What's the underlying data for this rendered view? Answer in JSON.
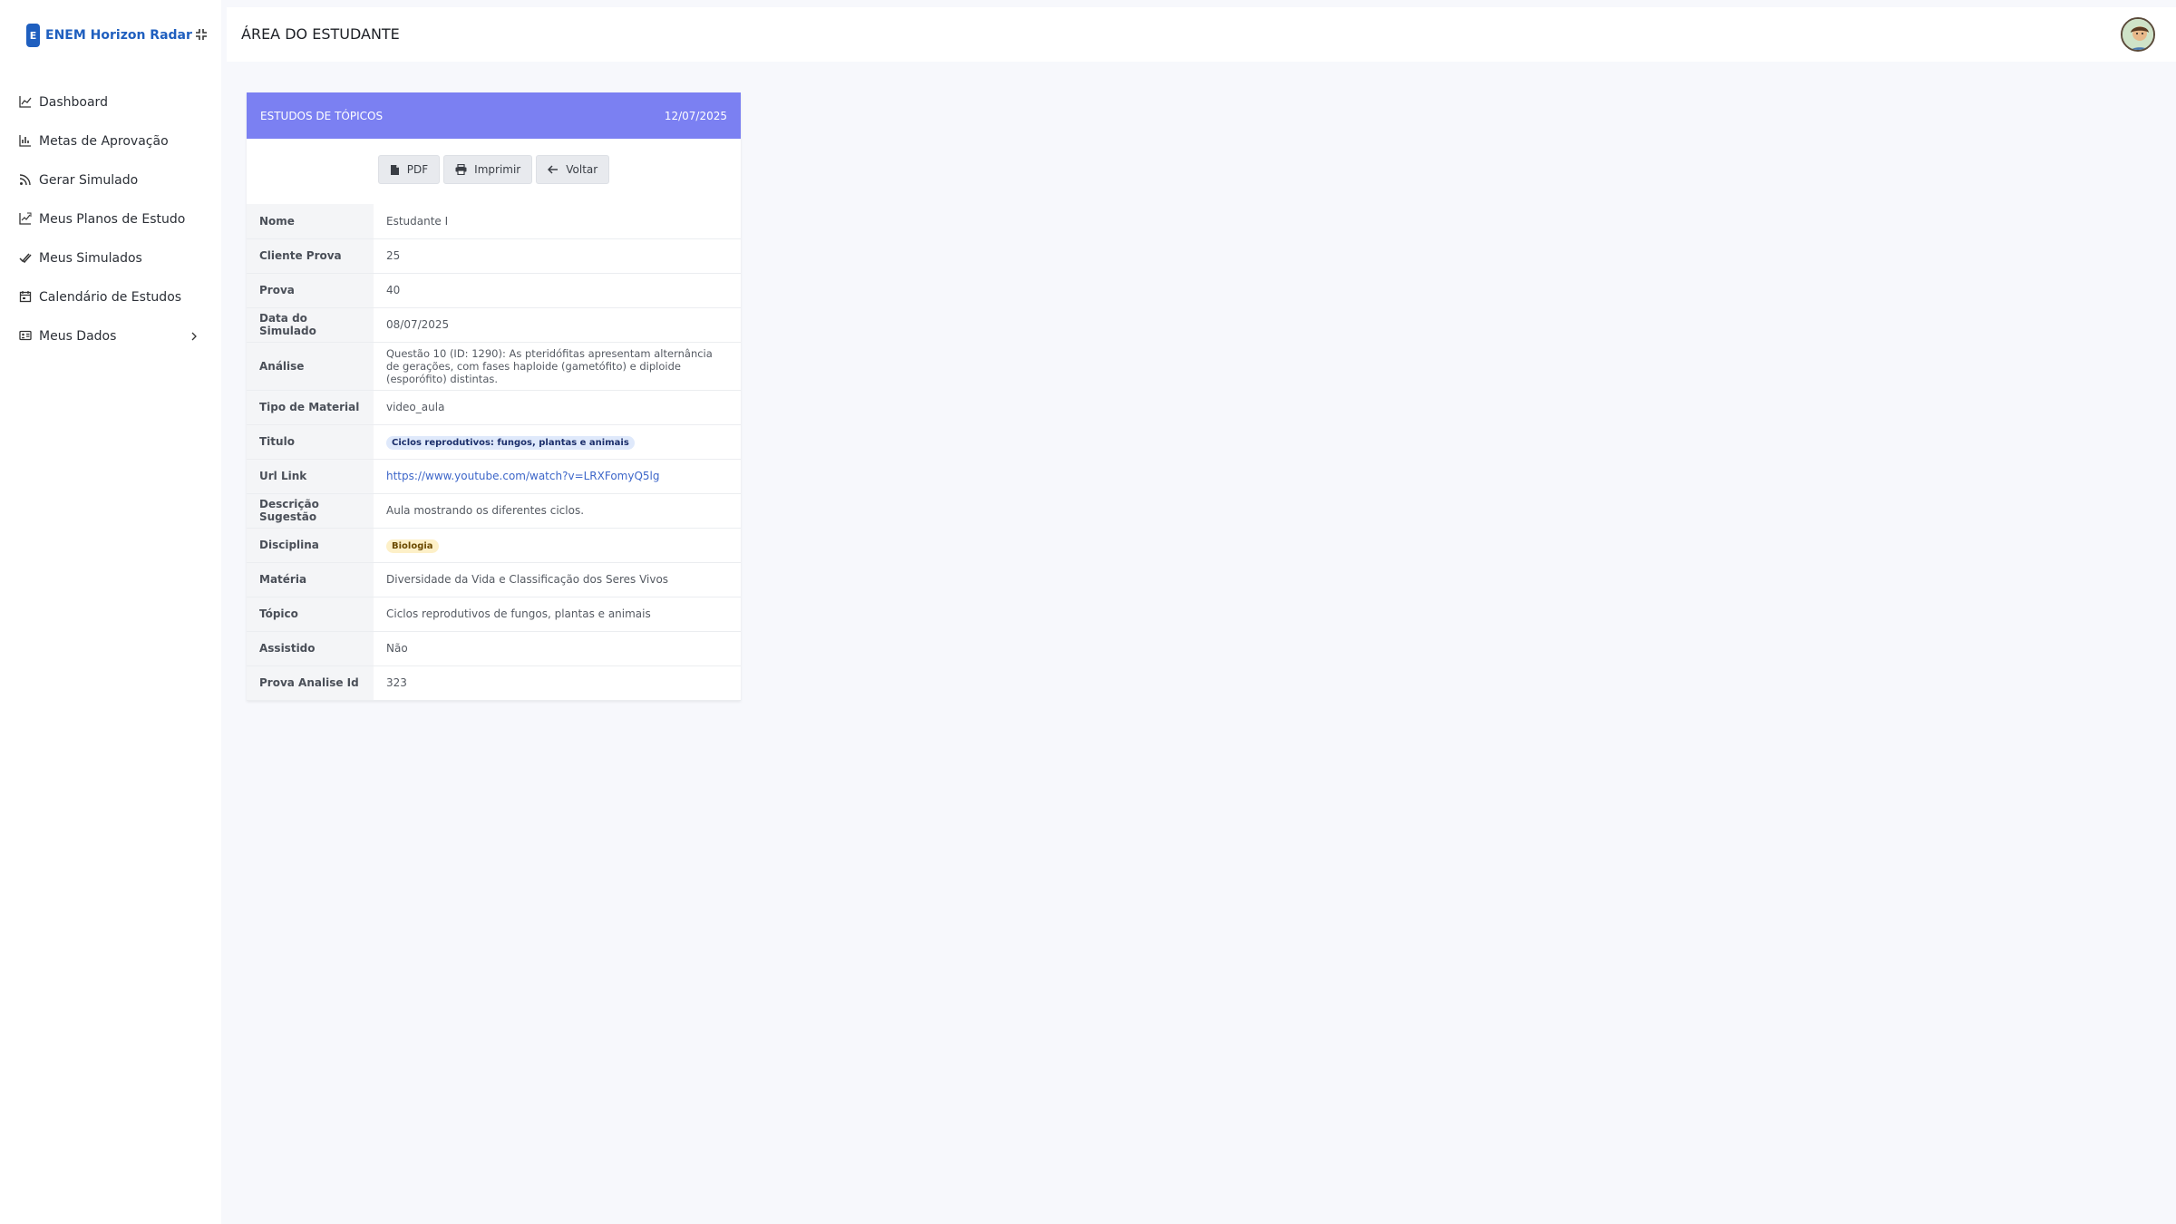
{
  "brand": {
    "badge": "E",
    "name": "ENEM Horizon Radar"
  },
  "sidebar": {
    "items": [
      {
        "label": "Dashboard",
        "icon": "chart-line-icon"
      },
      {
        "label": "Metas de Aprovação",
        "icon": "bar-chart-icon"
      },
      {
        "label": "Gerar Simulado",
        "icon": "rss-icon"
      },
      {
        "label": "Meus Planos de Estudo",
        "icon": "chart-grid-icon"
      },
      {
        "label": "Meus Simulados",
        "icon": "check-double-icon"
      },
      {
        "label": "Calendário de Estudos",
        "icon": "calendar-icon"
      },
      {
        "label": "Meus Dados",
        "icon": "id-card-icon",
        "has_submenu": true
      }
    ]
  },
  "header": {
    "title": "ÁREA DO ESTUDANTE"
  },
  "card": {
    "title": "ESTUDOS DE TÓPICOS",
    "date": "12/07/2025",
    "header_color": "#7b80f2",
    "buttons": {
      "pdf": "PDF",
      "print": "Imprimir",
      "back": "Voltar"
    },
    "rows": {
      "nome": {
        "label": "Nome",
        "value": "Estudante I"
      },
      "cliente_prova": {
        "label": "Cliente Prova",
        "value": "25"
      },
      "prova": {
        "label": "Prova",
        "value": "40"
      },
      "data_simulado": {
        "label": "Data do Simulado",
        "value": "08/07/2025"
      },
      "analise": {
        "label": "Análise",
        "value": "Questão 10 (ID: 1290): As pteridófitas apresentam alternância de gerações, com fases haploide (gametófito) e diploide (esporófito) distintas."
      },
      "tipo_material": {
        "label": "Tipo de Material",
        "value": "video_aula"
      },
      "titulo": {
        "label": "Titulo",
        "value": "Ciclos reprodutivos: fungos, plantas e animais"
      },
      "url_link": {
        "label": "Url Link",
        "value": "https://www.youtube.com/watch?v=LRXFomyQ5lg"
      },
      "descricao": {
        "label": "Descrição Sugestão",
        "value": "Aula mostrando os diferentes ciclos."
      },
      "disciplina": {
        "label": "Disciplina",
        "value": "Biologia"
      },
      "materia": {
        "label": "Matéria",
        "value": "Diversidade da Vida e Classificação dos Seres Vivos"
      },
      "topico": {
        "label": "Tópico",
        "value": "Ciclos reprodutivos de fungos, plantas e animais"
      },
      "assistido": {
        "label": "Assistido",
        "value": "Não"
      },
      "prova_analise_id": {
        "label": "Prova Analise Id",
        "value": "323"
      }
    }
  }
}
